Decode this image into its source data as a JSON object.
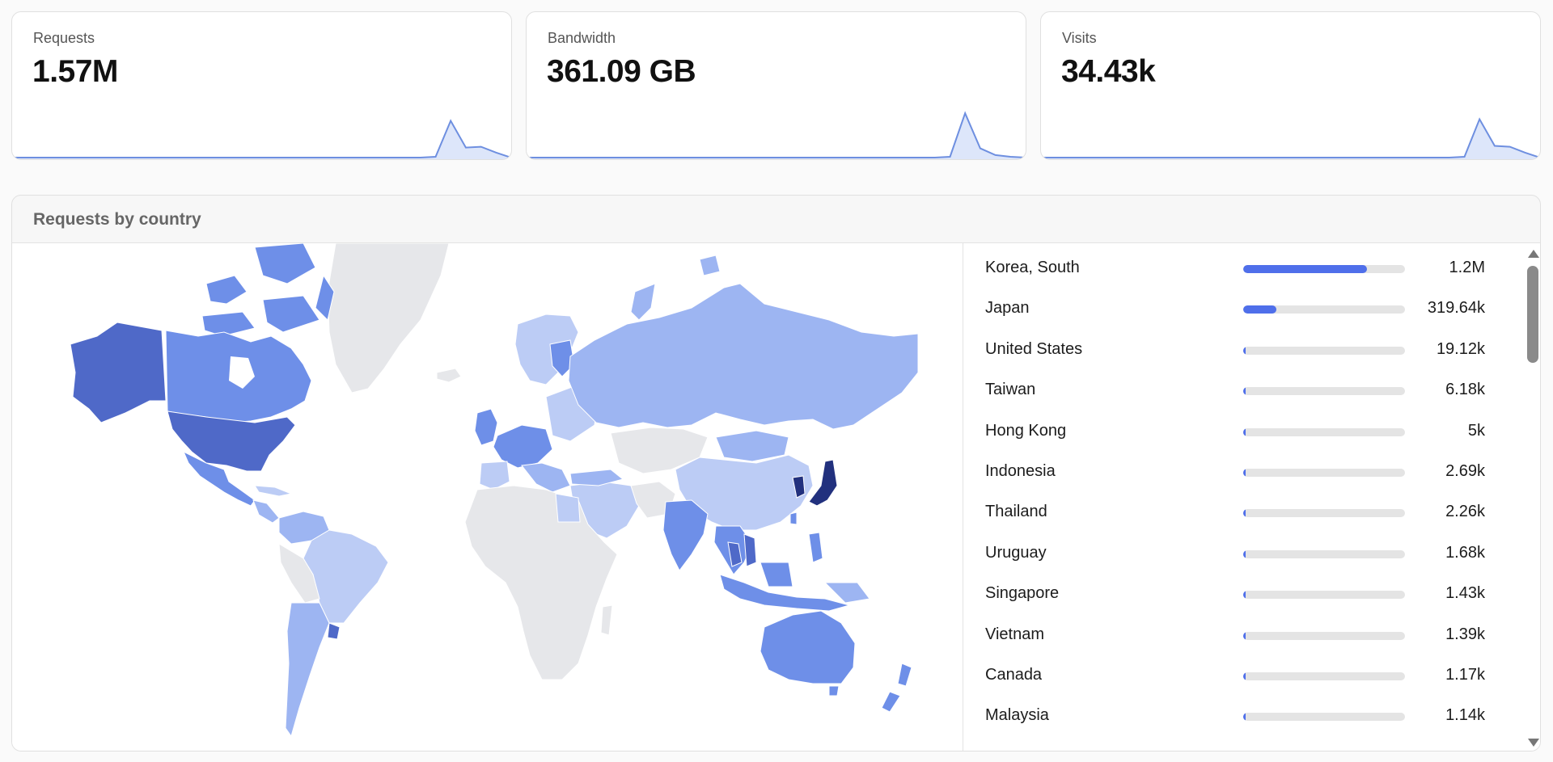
{
  "stats": [
    {
      "label": "Requests",
      "value": "1.57M",
      "series": [
        0,
        0,
        0,
        0,
        0,
        0,
        0,
        0,
        0,
        0,
        0,
        0,
        0,
        0,
        0,
        0,
        0,
        0,
        0,
        0,
        0,
        0,
        0,
        0,
        0,
        0,
        0,
        0,
        1,
        44,
        12,
        13,
        6,
        0
      ]
    },
    {
      "label": "Bandwidth",
      "value": "361.09 GB",
      "series": [
        0,
        0,
        0,
        0,
        0,
        0,
        0,
        0,
        0,
        0,
        0,
        0,
        0,
        0,
        0,
        0,
        0,
        0,
        0,
        0,
        0,
        0,
        0,
        0,
        0,
        0,
        0,
        0,
        1,
        53,
        11,
        3,
        1,
        0
      ]
    },
    {
      "label": "Visits",
      "value": "34.43k",
      "series": [
        0,
        0,
        0,
        0,
        0,
        0,
        0,
        0,
        0,
        0,
        0,
        0,
        0,
        0,
        0,
        0,
        0,
        0,
        0,
        0,
        0,
        0,
        0,
        0,
        0,
        0,
        0,
        0,
        1,
        46,
        14,
        13,
        6,
        0
      ]
    }
  ],
  "country_panel": {
    "title": "Requests by country",
    "countries": [
      {
        "name": "Korea, South",
        "count": "1.2M",
        "share": 0.764
      },
      {
        "name": "Japan",
        "count": "319.64k",
        "share": 0.204
      },
      {
        "name": "United States",
        "count": "19.12k",
        "share": 0.012
      },
      {
        "name": "Taiwan",
        "count": "6.18k",
        "share": 0.004
      },
      {
        "name": "Hong Kong",
        "count": "5k",
        "share": 0.003
      },
      {
        "name": "Indonesia",
        "count": "2.69k",
        "share": 0.002
      },
      {
        "name": "Thailand",
        "count": "2.26k",
        "share": 0.0014
      },
      {
        "name": "Uruguay",
        "count": "1.68k",
        "share": 0.001
      },
      {
        "name": "Singapore",
        "count": "1.43k",
        "share": 0.0009
      },
      {
        "name": "Vietnam",
        "count": "1.39k",
        "share": 0.0009
      },
      {
        "name": "Canada",
        "count": "1.17k",
        "share": 0.0007
      },
      {
        "name": "Malaysia",
        "count": "1.14k",
        "share": 0.0007
      }
    ]
  },
  "colors": {
    "accent": "#4f6fea",
    "spark_line": "#6e8fe0",
    "spark_fill": "#dde6fa",
    "map_none": "#e6e7ea",
    "map_low": "#bcccf5",
    "map_mid": "#9db5f2",
    "map_high": "#6e8fe8",
    "map_higher": "#4f69c8",
    "map_top": "#22317e"
  }
}
